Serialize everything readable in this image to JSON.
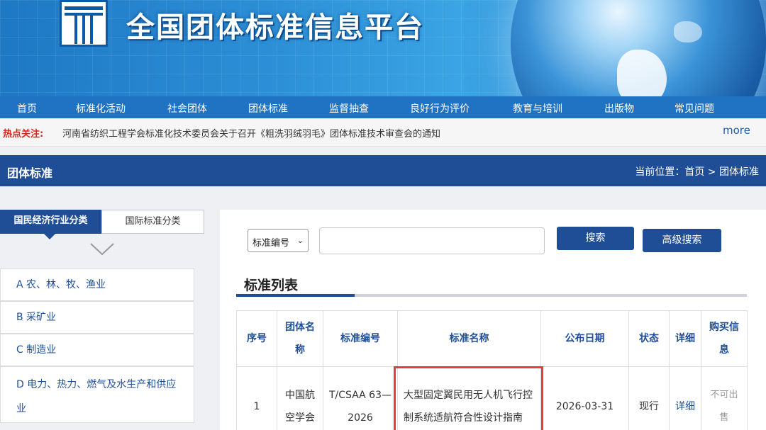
{
  "header": {
    "site_title": "全国团体标准信息平台"
  },
  "nav": {
    "items": [
      {
        "label": "首页"
      },
      {
        "label": "标准化活动"
      },
      {
        "label": "社会团体"
      },
      {
        "label": "团体标准"
      },
      {
        "label": "监督抽查"
      },
      {
        "label": "良好行为评价"
      },
      {
        "label": "教育与培训"
      },
      {
        "label": "出版物"
      },
      {
        "label": "常见问题"
      }
    ]
  },
  "hot": {
    "label": "热点关注:",
    "text": "河南省纺织工程学会标准化技术委员会关于召开《粗洗羽绒羽毛》团体标准技术审查会的通知",
    "more": "more"
  },
  "section": {
    "title": "团体标准",
    "breadcrumb": "当前位置：首页 > 团体标准"
  },
  "sidebar": {
    "tabs": [
      {
        "label": "国民经济行业分类"
      },
      {
        "label": "国际标准分类"
      }
    ],
    "categories": [
      {
        "label": "A 农、林、牧、渔业"
      },
      {
        "label": "B 采矿业"
      },
      {
        "label": "C 制造业"
      },
      {
        "label": "D 电力、热力、燃气及水生产和供应"
      },
      {
        "label": "业"
      }
    ]
  },
  "search": {
    "select_value": "标准编号",
    "input_value": "",
    "search_label": "搜索",
    "advanced_label": "高级搜索"
  },
  "list": {
    "title": "标准列表",
    "headers": [
      "序号",
      "团体名称",
      "标准编号",
      "标准名称",
      "公布日期",
      "状态",
      "详细",
      "购买信息"
    ],
    "rows": [
      {
        "no": "1",
        "org": "中国航空学会",
        "code": "T/CSAA 63—2026",
        "name": "大型固定翼民用无人机飞行控制系统适航符合性设计指南",
        "date": "2026-03-31",
        "status": "现行",
        "detail": "详细",
        "purchase": "不可出售"
      }
    ]
  },
  "colors": {
    "accent": "#1f4e97",
    "hot_red": "#d9231d",
    "highlight": "#e0403a"
  }
}
